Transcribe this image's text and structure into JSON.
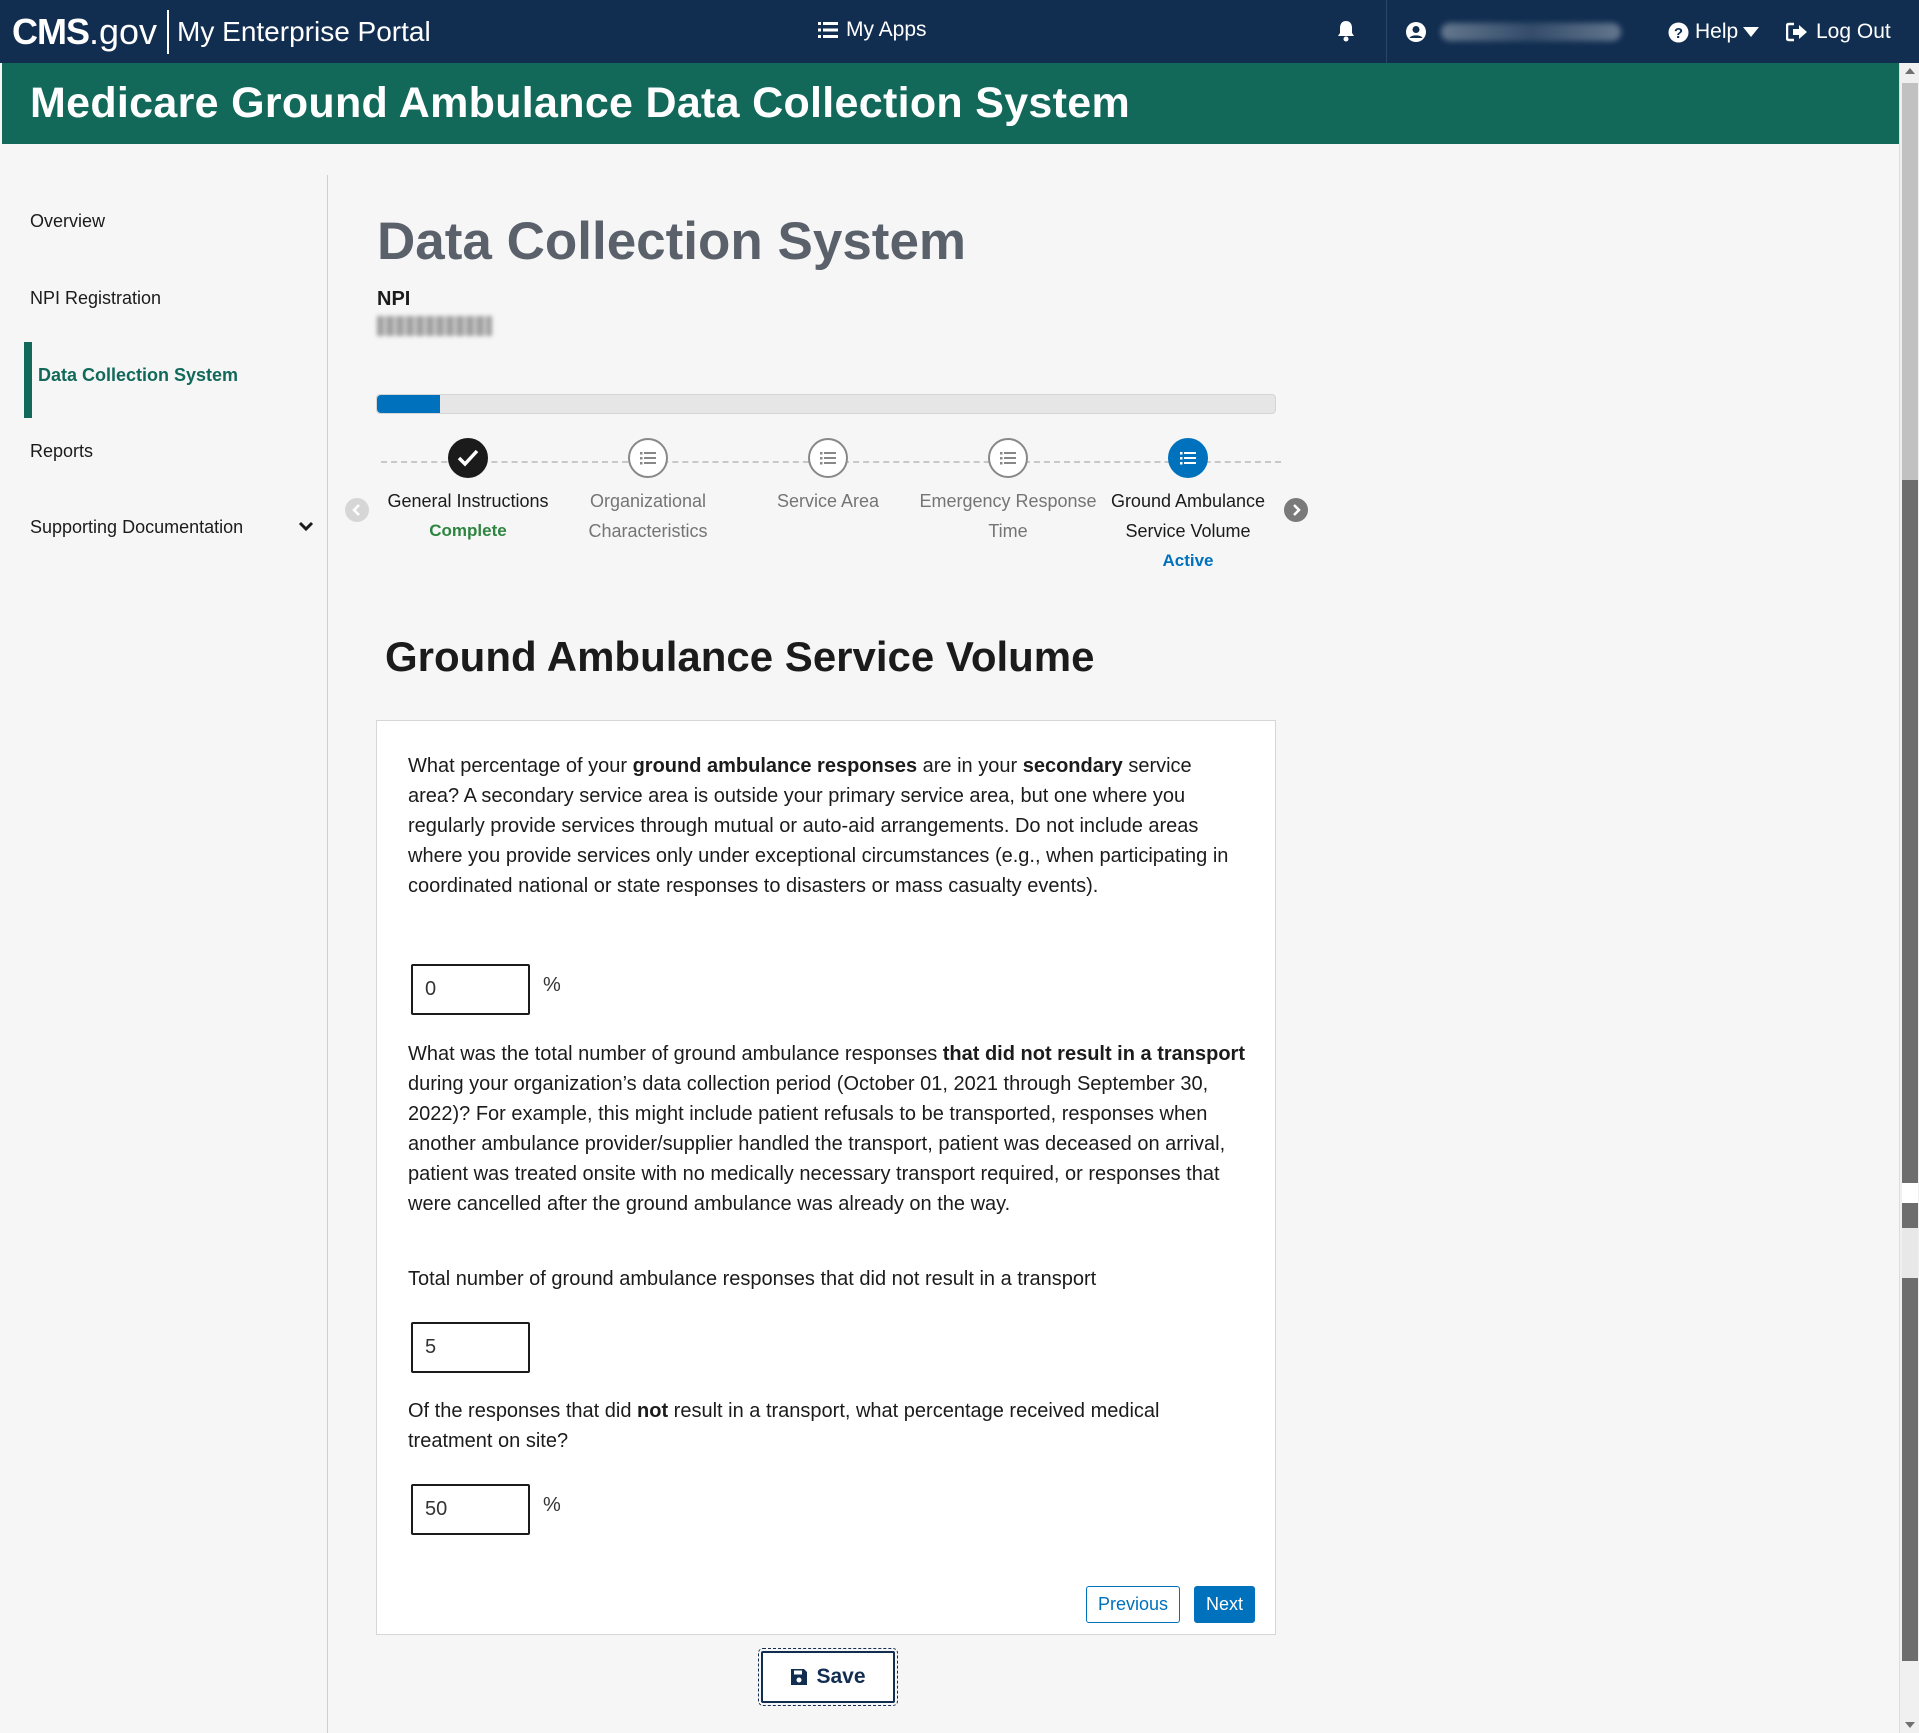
{
  "topbar": {
    "brand_cms": "CMS",
    "brand_gov": ".gov",
    "brand_portal": "My Enterprise Portal",
    "my_apps": "My Apps",
    "help": "Help",
    "logout": "Log Out"
  },
  "banner": {
    "title": "Medicare Ground Ambulance Data Collection System"
  },
  "sidebar": {
    "items": [
      {
        "label": "Overview"
      },
      {
        "label": "NPI Registration"
      },
      {
        "label": "Data Collection System"
      },
      {
        "label": "Reports"
      },
      {
        "label": "Supporting Documentation"
      }
    ]
  },
  "main": {
    "page_title": "Data Collection System",
    "npi_label": "NPI",
    "progress_fraction": 0.07,
    "steps": [
      {
        "line1": "General Instructions",
        "line2": "",
        "status": "Complete"
      },
      {
        "line1": "Organizational",
        "line2": "Characteristics",
        "status": ""
      },
      {
        "line1": "Service Area",
        "line2": "",
        "status": ""
      },
      {
        "line1": "Emergency Response",
        "line2": "Time",
        "status": ""
      },
      {
        "line1": "Ground Ambulance",
        "line2": "Service Volume",
        "status": "Active"
      }
    ],
    "section_title": "Ground Ambulance Service Volume"
  },
  "form": {
    "q1": {
      "t1": "What percentage of your ",
      "b1": "ground ambulance responses",
      "t2": " are in your ",
      "b2": "secondary",
      "t3": " service area? A secondary service area is outside your primary service area, but one where you regularly provide services through mutual or auto-aid arrangements. Do not include areas where you provide services only under exceptional circumstances (e.g., when participating in coordinated national or state responses to disasters or mass casualty events)."
    },
    "q1_value": "0",
    "q1_unit": "%",
    "q2": {
      "t1": "What was the total number of ground ambulance responses ",
      "b1": "that did not result in a transport",
      "t2": " during your organization’s data collection period (October 01, 2021 through September 30, 2022)? For example, this might include patient refusals to be transported, responses when another ambulance provider/supplier handled the transport, patient was deceased on arrival, patient was treated onsite with no medically necessary transport required, or responses that were cancelled after the ground ambulance was already on the way."
    },
    "q2_label": "Total number of ground ambulance responses that did not result in a transport",
    "q2_value": "5",
    "q3": {
      "t1": "Of the responses that did ",
      "b1": "not",
      "t2": " result in a transport, what percentage received medical treatment on site?"
    },
    "q3_value": "50",
    "q3_unit": "%",
    "previous": "Previous",
    "next": "Next",
    "save": "Save"
  }
}
